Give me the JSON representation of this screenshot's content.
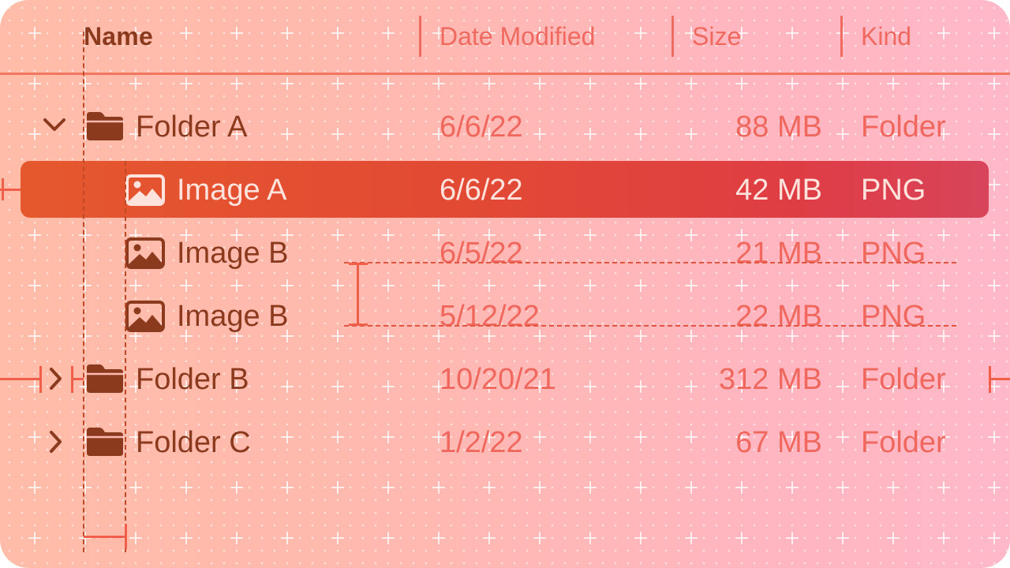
{
  "columns": {
    "name": "Name",
    "date_modified": "Date Modified",
    "size": "Size",
    "kind": "Kind"
  },
  "rows": [
    {
      "name": "Folder A",
      "date": "6/6/22",
      "size": "88 MB",
      "kind": "Folder",
      "icon": "folder-icon",
      "expanded": true
    },
    {
      "name": "Image A",
      "date": "6/6/22",
      "size": "42 MB",
      "kind": "PNG",
      "icon": "image-icon",
      "selected": true
    },
    {
      "name": "Image B",
      "date": "6/5/22",
      "size": "21 MB",
      "kind": "PNG",
      "icon": "image-icon"
    },
    {
      "name": "Image B",
      "date": "5/12/22",
      "size": "22 MB",
      "kind": "PNG",
      "icon": "image-icon"
    },
    {
      "name": "Folder B",
      "date": "10/20/21",
      "size": "312 MB",
      "kind": "Folder",
      "icon": "folder-icon",
      "expanded": false
    },
    {
      "name": "Folder C",
      "date": "1/2/22",
      "size": "67 MB",
      "kind": "Folder",
      "icon": "folder-icon",
      "expanded": false
    }
  ],
  "colors": {
    "selection": "#e24a33",
    "primary_text": "#8c3a1e",
    "secondary_text": "#f0685d",
    "guide": "#ef5f49"
  }
}
